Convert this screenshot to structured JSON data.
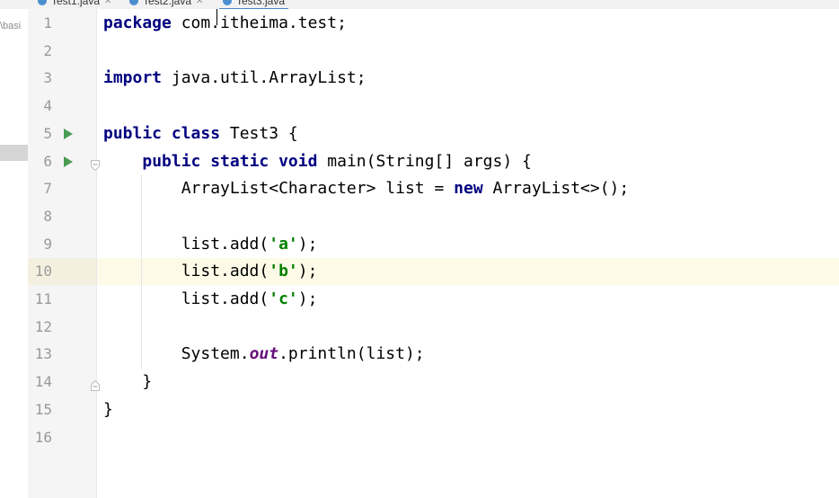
{
  "tabs": [
    {
      "label": "Test1.java",
      "active": false
    },
    {
      "label": "Test2.java",
      "active": false
    },
    {
      "label": "Test3.java",
      "active": true
    }
  ],
  "project_panel": {
    "path_text": "\\basi"
  },
  "editor": {
    "current_line": 10,
    "lines": [
      {
        "number": "1",
        "tokens": [
          {
            "t": "package",
            "c": "kw"
          },
          {
            "t": " com.itheima.test;"
          }
        ]
      },
      {
        "number": "2",
        "tokens": []
      },
      {
        "number": "3",
        "tokens": [
          {
            "t": "import",
            "c": "kw"
          },
          {
            "t": " java.util.ArrayList;"
          }
        ]
      },
      {
        "number": "4",
        "tokens": []
      },
      {
        "number": "5",
        "run": true,
        "tokens": [
          {
            "t": "public class",
            "c": "kw"
          },
          {
            "t": " Test3 {"
          }
        ]
      },
      {
        "number": "6",
        "run": true,
        "fold": "open",
        "tokens": [
          {
            "t": "    "
          },
          {
            "t": "public static void",
            "c": "kw"
          },
          {
            "t": " main(String[] args) {"
          }
        ]
      },
      {
        "number": "7",
        "tokens": [
          {
            "t": "        ArrayList<Character> list = "
          },
          {
            "t": "new",
            "c": "kw"
          },
          {
            "t": " ArrayList<>();"
          }
        ]
      },
      {
        "number": "8",
        "tokens": []
      },
      {
        "number": "9",
        "tokens": [
          {
            "t": "        list.add("
          },
          {
            "t": "'a'",
            "c": "str"
          },
          {
            "t": ");"
          }
        ]
      },
      {
        "number": "10",
        "tokens": [
          {
            "t": "        list.add("
          },
          {
            "t": "'b'",
            "c": "str"
          },
          {
            "t": ");"
          }
        ]
      },
      {
        "number": "11",
        "tokens": [
          {
            "t": "        list.add("
          },
          {
            "t": "'c'",
            "c": "str"
          },
          {
            "t": ");"
          }
        ]
      },
      {
        "number": "12",
        "tokens": []
      },
      {
        "number": "13",
        "tokens": [
          {
            "t": "        System."
          },
          {
            "t": "out",
            "c": "fld"
          },
          {
            "t": ".println(list);"
          }
        ]
      },
      {
        "number": "14",
        "fold": "close",
        "tokens": [
          {
            "t": "    }"
          }
        ]
      },
      {
        "number": "15",
        "tokens": [
          {
            "t": "}"
          }
        ]
      },
      {
        "number": "16",
        "tokens": []
      }
    ]
  }
}
